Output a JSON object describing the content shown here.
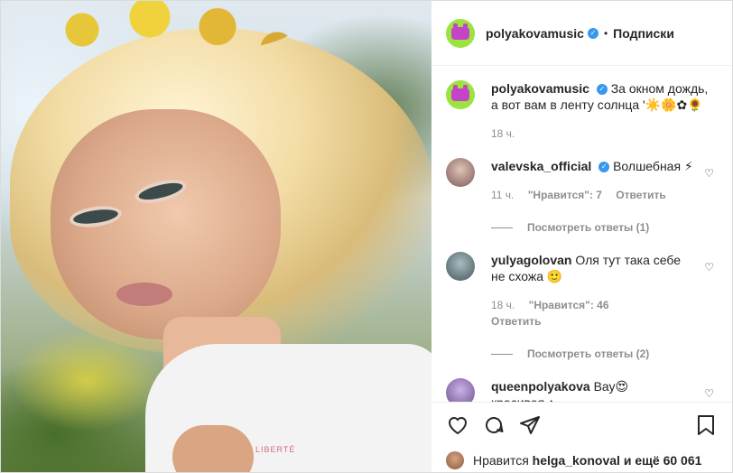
{
  "post": {
    "author": "polyakovamusic",
    "dot": "•",
    "follow_label": "Подписки",
    "print_text": "LIBERTÉ"
  },
  "caption": {
    "user": "polyakovamusic",
    "text": "За окном дождь, а вот вам в ленту солнца '☀️🌼✿🌻",
    "time": "18 ч."
  },
  "comments": [
    {
      "user": "valevska_official",
      "verified": true,
      "text": "Волшебная ⚡",
      "time": "11 ч.",
      "likes": "\"Нравится\": 7",
      "reply": "Ответить",
      "replies": "Посмотреть ответы (1)"
    },
    {
      "user": "yulyagolovan",
      "verified": false,
      "text": "Оля тут така себе не схожа 🙂",
      "time": "18 ч.",
      "likes": "\"Нравится\": 46",
      "reply": "Ответить",
      "replies": "Посмотреть ответы (2)"
    },
    {
      "user": "queenpolyakova",
      "verified": false,
      "text": "Вау😍 красивая ♠",
      "time": "",
      "likes": "",
      "reply": "",
      "replies": ""
    }
  ],
  "likes_bar": {
    "prefix": "Нравится",
    "user": "helga_konoval",
    "suffix": "и ещё 60 061"
  },
  "colors": {
    "accent": "#3897f0",
    "avatar_bg": "#9be33f",
    "avatar_fg": "#c443c6"
  }
}
